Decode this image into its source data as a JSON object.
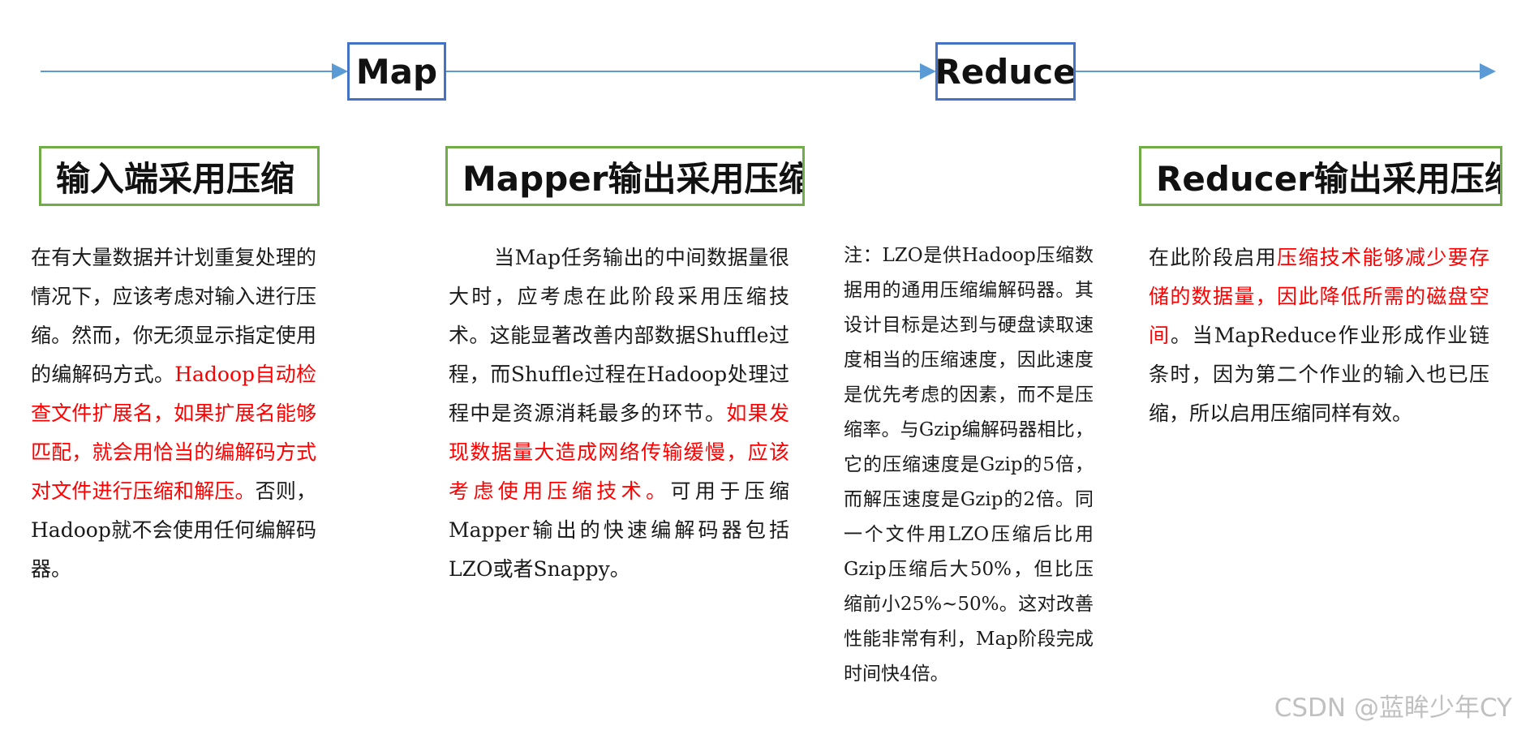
{
  "stages": {
    "map_label": "Map",
    "reduce_label": "Reduce"
  },
  "headers": {
    "input": "输入端采用压缩",
    "mapper": "Mapper输出采用压缩",
    "reducer": "Reducer输出采用压缩"
  },
  "input_text": {
    "a": "在有大量数据并计划重复处理的情况下，应该考虑对输入进行压缩。然而，你无须显示指定使用的编解码方式。",
    "b": "Hadoop自动检查文件扩展名，如果扩展名能够匹配，就会用恰当的编解码方式对文件进行压缩和解压。",
    "c": "否则，Hadoop就不会使用任何编解码器。"
  },
  "mapper_text": {
    "a": "当Map任务输出的中间数据量很大时，应考虑在此阶段采用压缩技术。这能显著改善内部数据Shuffle过程，而Shuffle过程在Hadoop处理过程中是资源消耗最多的环节。",
    "b": "如果发现数据量大造成网络传输缓慢，应该考虑使用压缩技术。",
    "c": "可用于压缩Mapper输出的快速编解码器包括LZO或者Snappy。"
  },
  "note_text": "注：LZO是供Hadoop压缩数据用的通用压缩编解码器。其设计目标是达到与硬盘读取速度相当的压缩速度，因此速度是优先考虑的因素，而不是压缩率。与Gzip编解码器相比，它的压缩速度是Gzip的5倍，而解压速度是Gzip的2倍。同一个文件用LZO压缩后比用Gzip压缩后大50%，但比压缩前小25%~50%。这对改善性能非常有利，Map阶段完成时间快4倍。",
  "reducer_text": {
    "a": "在此阶段启用",
    "b": "压缩技术能够减少要存储的数据量，因此降低所需的磁盘空间",
    "c": "。当MapReduce作业形成作业链条时，因为第二个作业的输入也已压缩，所以启用压缩同样有效。"
  },
  "watermark": "CSDN @蓝眸少年CY",
  "colors": {
    "arrow": "#5b9bd5",
    "stage_border": "#4472c4",
    "header_border": "#70ad47",
    "highlight": "#ff0000"
  }
}
